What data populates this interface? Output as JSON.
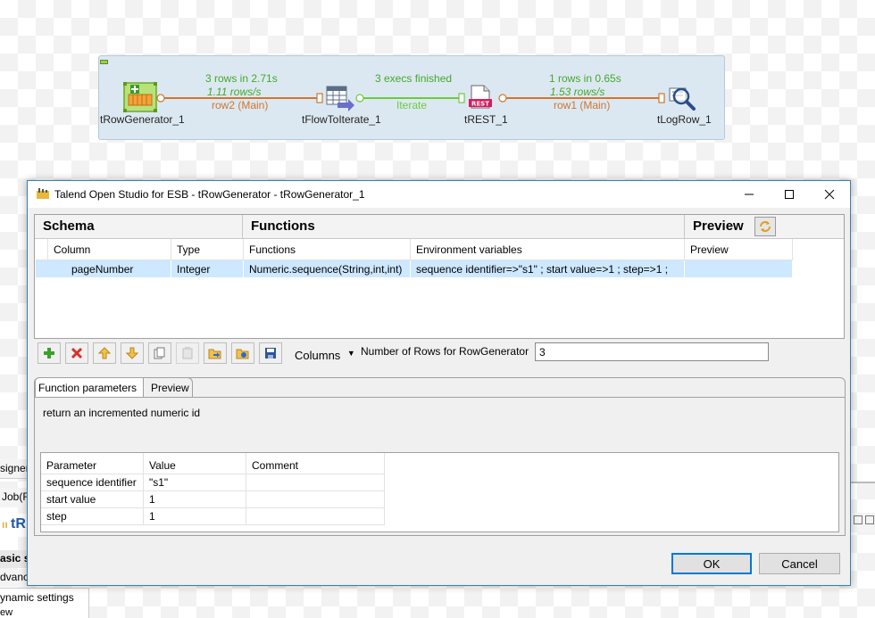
{
  "job": {
    "components": [
      {
        "name": "tRowGenerator_1"
      },
      {
        "name": "tFlowToIterate_1"
      },
      {
        "name": "tREST_1",
        "badge": "REST"
      },
      {
        "name": "tLogRow_1"
      }
    ],
    "links": [
      {
        "stat": "3 rows in 2.71s",
        "rate": "1.11 rows/s",
        "label": "row2 (Main)"
      },
      {
        "stat": "3 execs finished",
        "label": "Iterate"
      },
      {
        "stat": "1 rows in 0.65s",
        "rate": "1.53 rows/s",
        "label": "row1 (Main)"
      }
    ]
  },
  "background": {
    "frag1": "signer",
    "frag2": "Job(R",
    "frag3": "tR",
    "frag4": "asic se",
    "frag5": "dvance",
    "frag6": "ynamic settings",
    "frag7": "ew"
  },
  "dialog": {
    "title": "Talend Open Studio for ESB - tRowGenerator - tRowGenerator_1",
    "sections": {
      "schema": "Schema",
      "functions": "Functions",
      "preview": "Preview"
    },
    "columns": [
      "Column",
      "Type",
      "Functions",
      "Environment variables",
      "Preview"
    ],
    "row": {
      "column": "pageNumber",
      "type": "Integer",
      "function": "Numeric.sequence(String,int,int)",
      "env": "sequence identifier=>\"s1\" ; start value=>1 ; step=>1 ;",
      "preview": ""
    },
    "toolbar": {
      "columns_label": "Columns",
      "rows_label": "Number of Rows for RowGenerator",
      "rows_value": "3"
    },
    "tabs": {
      "params": "Function parameters",
      "preview": "Preview"
    },
    "description": "return an incremented numeric id",
    "param_headers": [
      "Parameter",
      "Value",
      "Comment"
    ],
    "params": [
      {
        "parameter": "sequence identifier",
        "value": "\"s1\"",
        "comment": ""
      },
      {
        "parameter": "start value",
        "value": "1",
        "comment": ""
      },
      {
        "parameter": "step",
        "value": "1",
        "comment": ""
      }
    ],
    "ok": "OK",
    "cancel": "Cancel"
  }
}
